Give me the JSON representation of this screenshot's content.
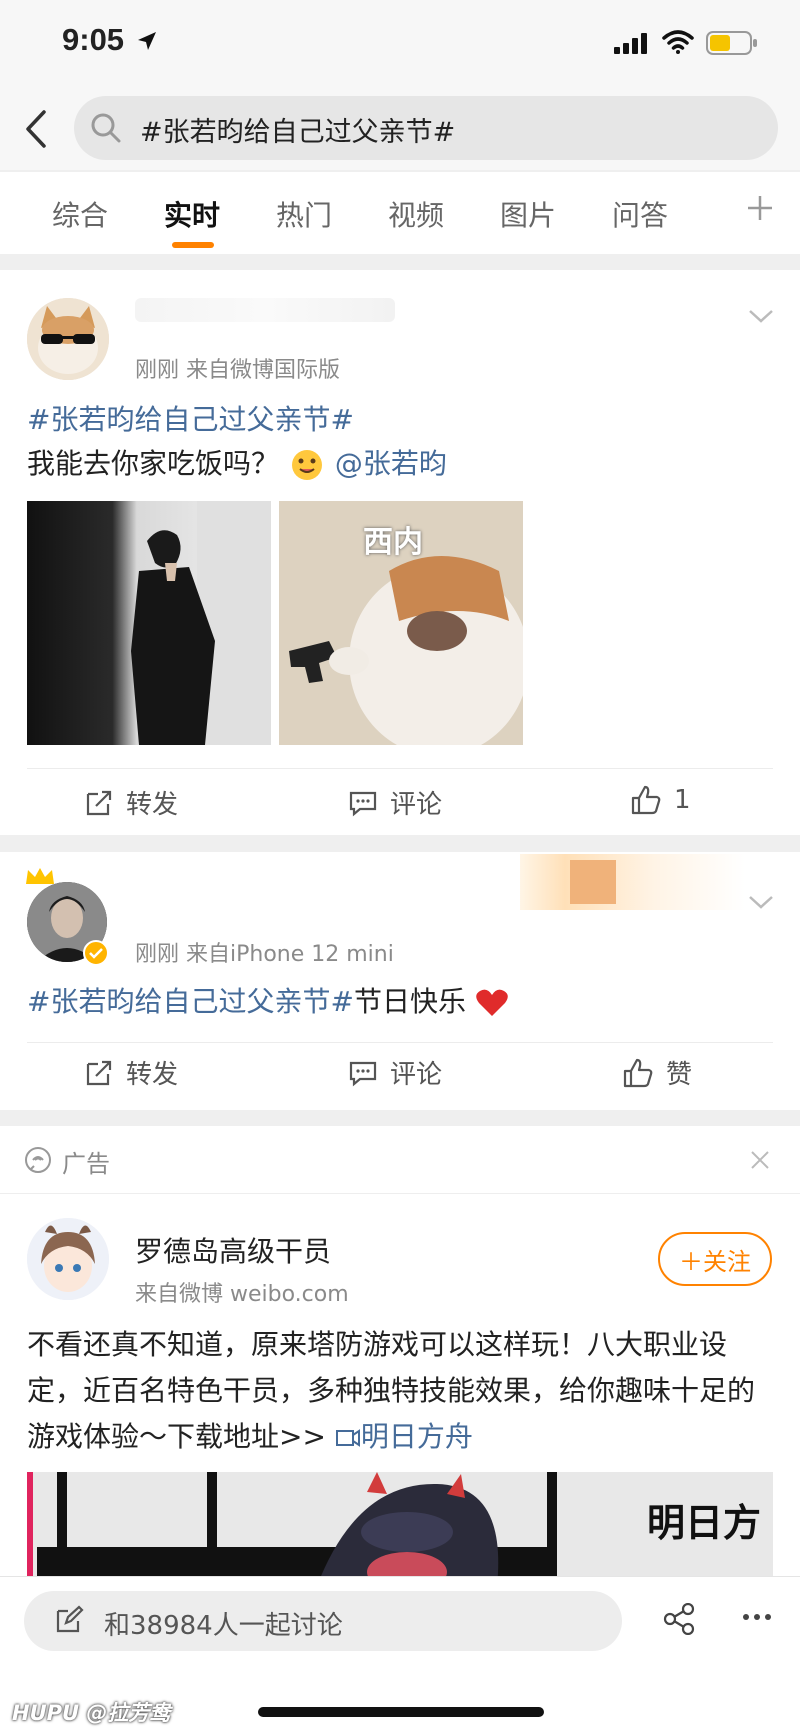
{
  "status_bar": {
    "time": "9:05",
    "battery_color": "#f5c400"
  },
  "search": {
    "query": "#张若昀给自己过父亲节#"
  },
  "tabs": [
    {
      "label": "综合"
    },
    {
      "label": "实时"
    },
    {
      "label": "热门"
    },
    {
      "label": "视频"
    },
    {
      "label": "图片"
    },
    {
      "label": "问答"
    }
  ],
  "active_tab": "实时",
  "accent_color": "#ff8200",
  "link_color": "#456b99",
  "posts": [
    {
      "meta": "刚刚  来自微博国际版",
      "topic": "#张若昀给自己过父亲节#",
      "text": "我能去你家吃饭吗？",
      "mention": "@张若昀",
      "images": [
        {
          "caption": ""
        },
        {
          "caption": "西内"
        }
      ],
      "actions": {
        "repost": "转发",
        "comment": "评论",
        "like": "1"
      }
    },
    {
      "meta": "刚刚  来自iPhone 12 mini",
      "topic": "#张若昀给自己过父亲节#",
      "text": "节日快乐",
      "actions": {
        "repost": "转发",
        "comment": "评论",
        "like": "赞"
      }
    }
  ],
  "ad": {
    "label": "广告",
    "name": "罗德岛高级干员",
    "source": "来自微博 weibo.com",
    "follow": "＋关注",
    "text": "不看还真不知道，原来塔防游戏可以这样玩！八大职业设定，近百名特色干员，多种独特技能效果，给你趣味十足的游戏体验～下载地址>> ",
    "link": "明日方舟",
    "banner_text": "明日方"
  },
  "bottom": {
    "discuss": "和38984人一起讨论",
    "watermark": "HUPU @拉芳鸯"
  }
}
